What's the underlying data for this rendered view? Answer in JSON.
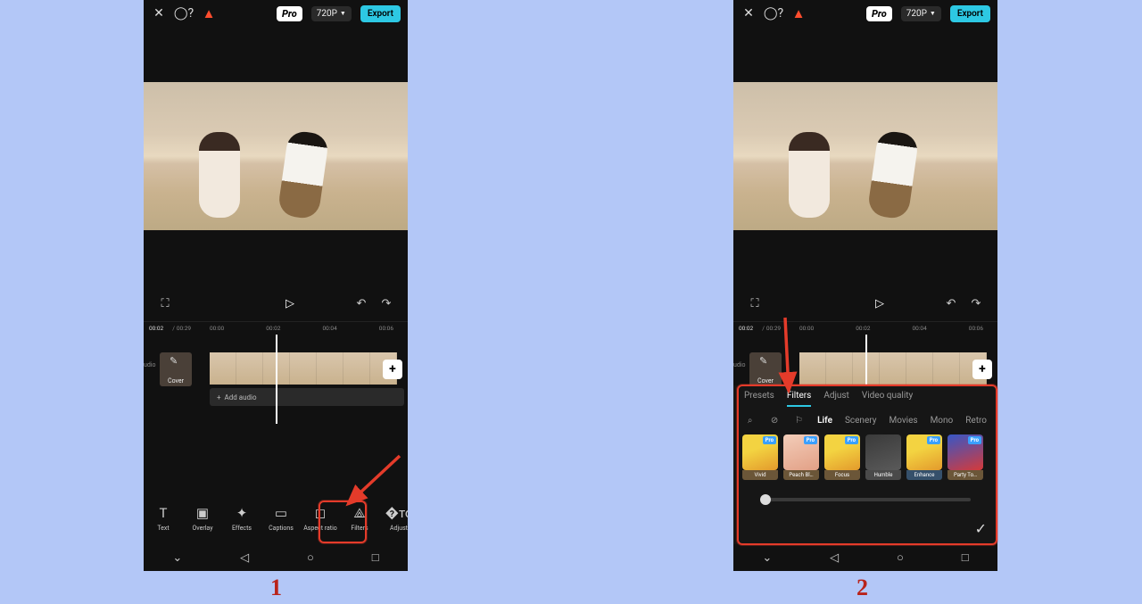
{
  "header": {
    "pro_label": "Pro",
    "resolution": "720P",
    "export": "Export"
  },
  "time": {
    "current": "00:02",
    "total": "00:29",
    "marks": [
      "00:00",
      "00:02",
      "00:04",
      "00:06"
    ]
  },
  "cover_label": "Cover",
  "audio_label": "udio",
  "add_audio": "Add audio",
  "tools": [
    {
      "label": "Text"
    },
    {
      "label": "Overlay"
    },
    {
      "label": "Effects"
    },
    {
      "label": "Captions"
    },
    {
      "label": "Aspect ratio"
    },
    {
      "label": "Filters"
    },
    {
      "label": "Adjust"
    }
  ],
  "filter_tabs": [
    {
      "label": "Presets"
    },
    {
      "label": "Filters",
      "active": true
    },
    {
      "label": "Adjust"
    },
    {
      "label": "Video quality"
    }
  ],
  "filter_cats": [
    {
      "label": "Life",
      "active": true
    },
    {
      "label": "Scenery"
    },
    {
      "label": "Movies"
    },
    {
      "label": "Mono"
    },
    {
      "label": "Retro"
    }
  ],
  "filter_thumbs": [
    {
      "label": "Vivid",
      "pro": true
    },
    {
      "label": "Peach Bl…",
      "pro": true
    },
    {
      "label": "Focus",
      "pro": true
    },
    {
      "label": "Humble"
    },
    {
      "label": "Enhance",
      "pro": true
    },
    {
      "label": "Party To…",
      "pro": true
    }
  ],
  "pro_tag": "Pro",
  "steps": {
    "one": "1",
    "two": "2"
  }
}
